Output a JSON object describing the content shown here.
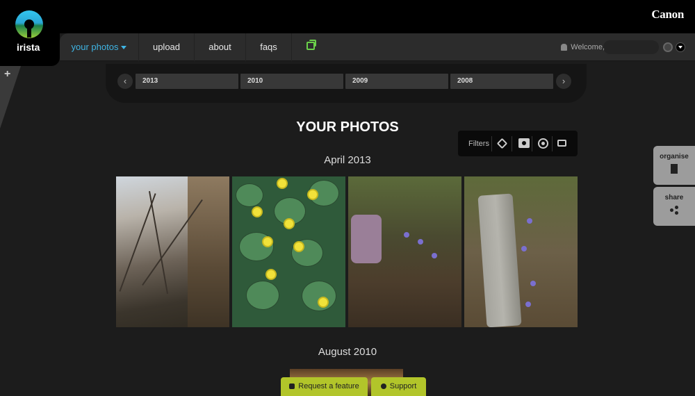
{
  "header": {
    "brand": "Canon",
    "logo_text": "irista"
  },
  "nav": {
    "items": [
      {
        "label": "your photos"
      },
      {
        "label": "upload"
      },
      {
        "label": "about"
      },
      {
        "label": "faqs"
      }
    ],
    "welcome": "Welcome,"
  },
  "sidebar": {
    "plus": "+"
  },
  "years": {
    "prev": "‹",
    "next": "›",
    "items": [
      "2013",
      "2010",
      "2009",
      "2008"
    ]
  },
  "page": {
    "title": "YOUR PHOTOS"
  },
  "filters": {
    "label": "Filters",
    "icons": [
      "tag-icon",
      "camera-icon",
      "target-icon",
      "chat-icon"
    ]
  },
  "sections": [
    {
      "title": "April 2013"
    },
    {
      "title": "August 2010"
    }
  ],
  "side_buttons": {
    "organise": "organise",
    "share": "share"
  },
  "bottom_buttons": {
    "request": "Request a feature",
    "support": "Support"
  },
  "colors": {
    "accent": "#3fb5e5",
    "green_icon": "#6ad04a",
    "bottom_button": "#b2c52a"
  }
}
